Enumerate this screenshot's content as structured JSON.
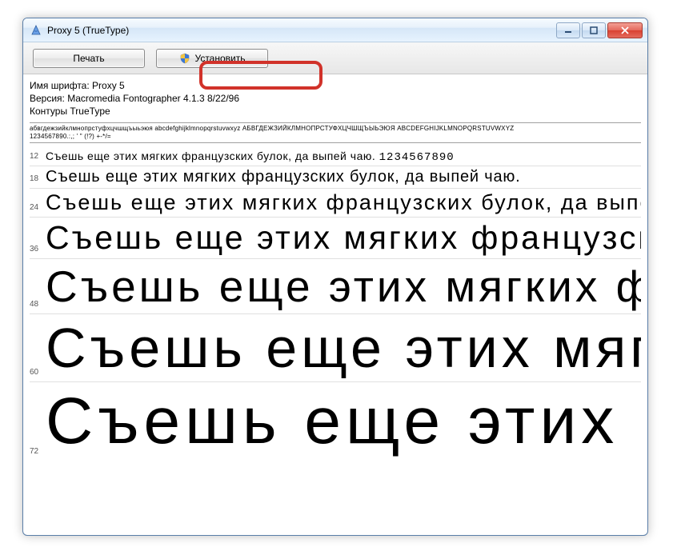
{
  "window": {
    "title": "Proxy 5 (TrueType)"
  },
  "toolbar": {
    "print_label": "Печать",
    "install_label": "Установить"
  },
  "meta": {
    "font_name_line": "Имя шрифта: Proxy 5",
    "version_line": "Версия: Macromedia Fontographer 4.1.3 8/22/96",
    "outlines_line": "Контуры TrueType"
  },
  "charset": {
    "line1": "абвгдежзийклмнопрстуфхцчшщъыьэюя abcdefghijklmnopqrstuvwxyz АБВГДЕЖЗИЙКЛМНОПРСТУФХЦЧШЩЪЫЬЭЮЯ ABCDEFGHIJKLMNOPQRSTUVWXYZ",
    "line2": "1234567890.:,; ' \" (!?) +-*/="
  },
  "pangram": {
    "full": "Съешь еще этих мягких французских булок, да выпей чаю.",
    "digits": "1234567890",
    "sizes": [
      12,
      18,
      24,
      36,
      48,
      60,
      72
    ]
  }
}
